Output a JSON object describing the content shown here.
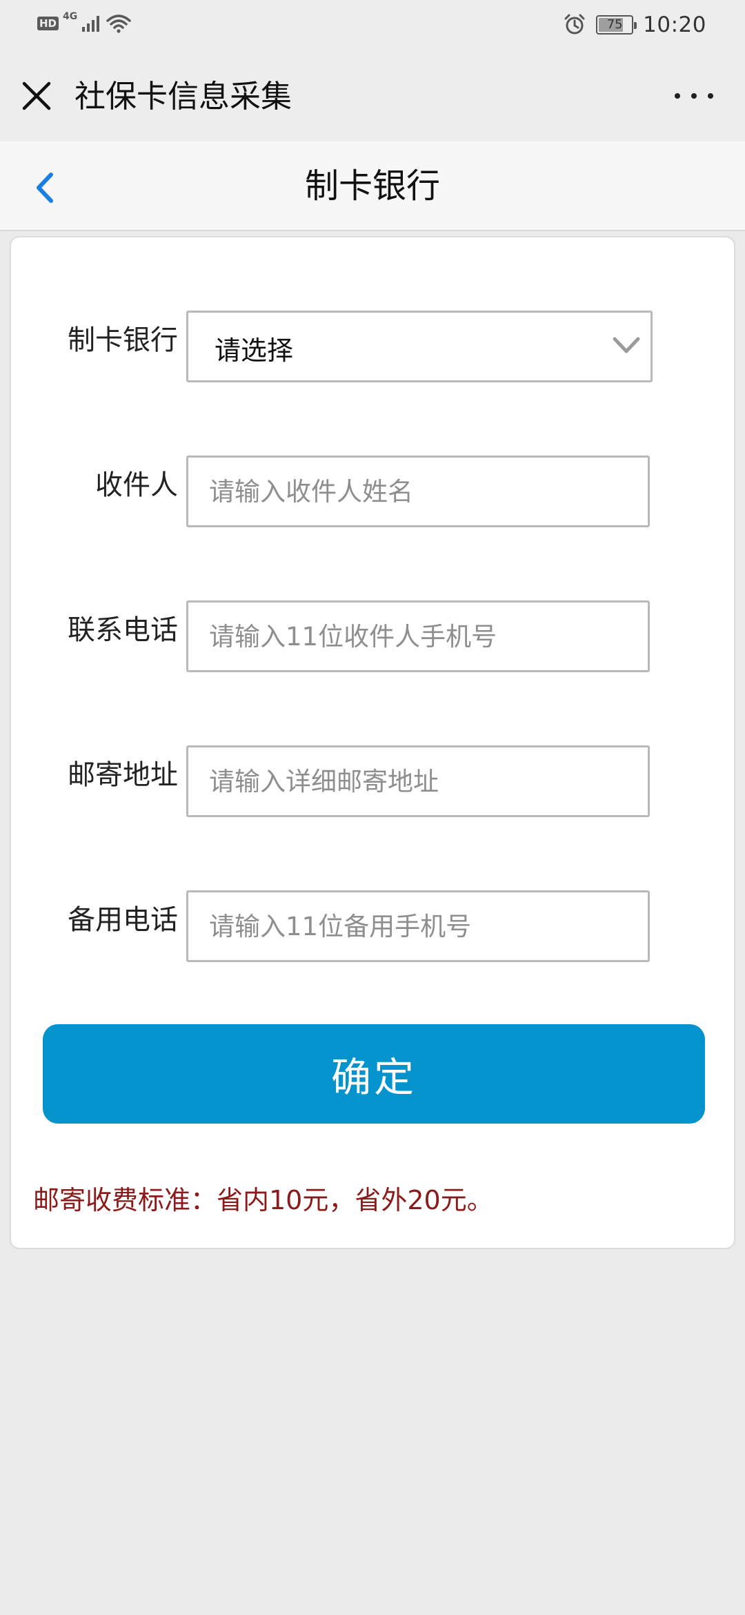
{
  "status_bar": {
    "hd": "HD",
    "network": "4G",
    "battery": "75",
    "battery_level": 0.75,
    "time": "10:20",
    "icons": [
      "signal-icon",
      "wifi-icon",
      "alarm-icon",
      "battery-icon"
    ]
  },
  "title_bar": {
    "title": "社保卡信息采集",
    "close_icon": "close-icon",
    "more_icon": "more-icon"
  },
  "page": {
    "title": "制卡银行",
    "back_icon": "chevron-left-icon"
  },
  "form": {
    "bank": {
      "label": "制卡银行",
      "value": "请选择",
      "icon": "chevron-down-icon"
    },
    "recipient": {
      "label": "收件人",
      "placeholder": "请输入收件人姓名",
      "value": ""
    },
    "phone": {
      "label": "联系电话",
      "placeholder": "请输入11位收件人手机号",
      "value": ""
    },
    "address": {
      "label": "邮寄地址",
      "placeholder": "请输入详细邮寄地址",
      "value": ""
    },
    "backup_phone": {
      "label": "备用电话",
      "placeholder": "请输入11位备用手机号",
      "value": ""
    },
    "submit_label": "确定",
    "note": "邮寄收费标准：省内10元，省外20元。"
  },
  "colors": {
    "accent": "#0493cd",
    "back_icon": "#1a7fe0",
    "note_text": "#8b1a1a",
    "background": "#ebebeb"
  }
}
